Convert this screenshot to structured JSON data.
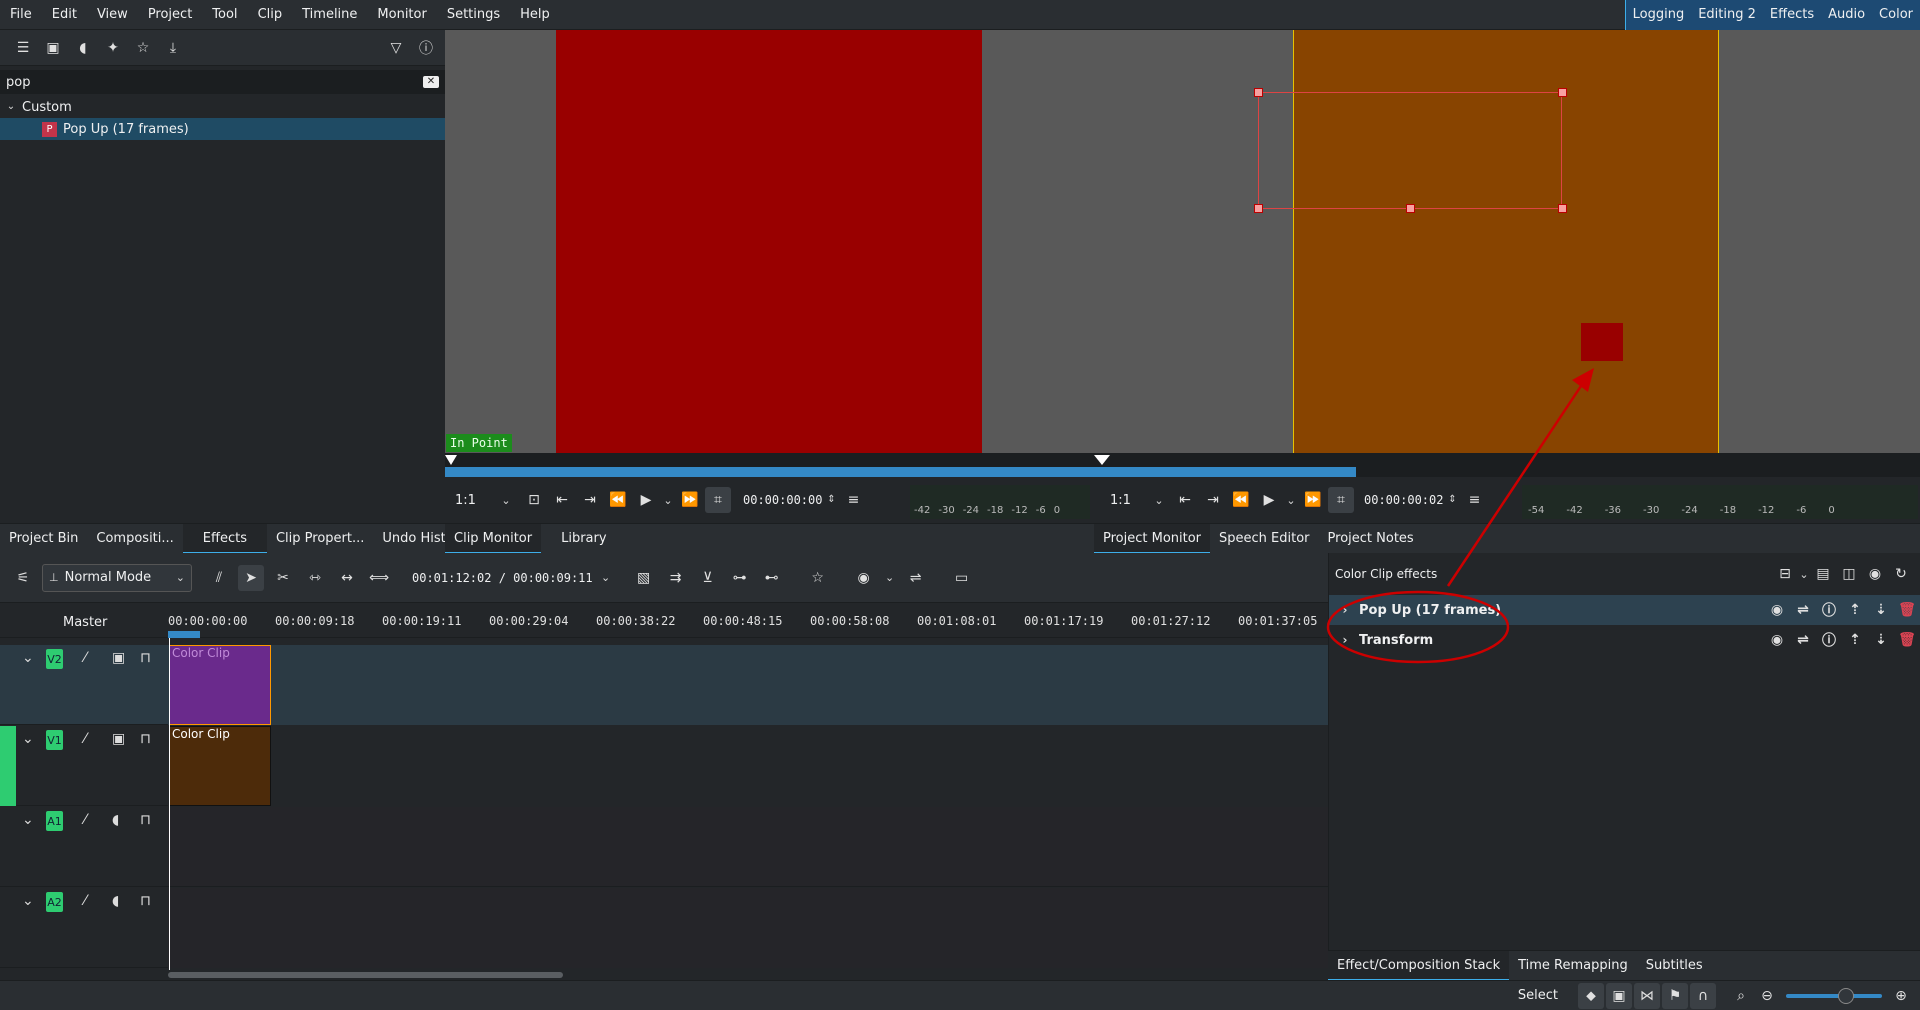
{
  "menu": {
    "items": [
      "File",
      "Edit",
      "View",
      "Project",
      "Tool",
      "Clip",
      "Timeline",
      "Monitor",
      "Settings",
      "Help"
    ],
    "layouts": [
      "Logging",
      "Editing 2",
      "Effects",
      "Audio",
      "Color"
    ]
  },
  "effects_panel": {
    "search_value": "pop",
    "category": "Custom",
    "item": "Pop Up (17 frames)",
    "item_badge": "P"
  },
  "left_tabs": [
    "Project Bin",
    "Compositi...",
    "Effects",
    "Clip Propert...",
    "Undo Hist..."
  ],
  "clip_monitor": {
    "in_point_label": "In Point",
    "zoom": "1:1",
    "timecode": "00:00:00:00",
    "vu_ticks": [
      "-42",
      "-30",
      "-24",
      "-18",
      "-12",
      "-6",
      "0"
    ],
    "tabs": [
      "Clip Monitor",
      "Library"
    ]
  },
  "project_monitor": {
    "zoom": "1:1",
    "timecode": "00:00:00:02",
    "vu_ticks": [
      "-54",
      "-42",
      "-36",
      "-30",
      "-24",
      "-18",
      "-12",
      "-6",
      "0"
    ],
    "tabs": [
      "Project Monitor",
      "Speech Editor",
      "Project Notes"
    ]
  },
  "timeline": {
    "mode": "Normal Mode",
    "timecode": "00:01:12:02 / 00:00:09:11",
    "master_label": "Master",
    "ruler": [
      "00:00:00:00",
      "00:00:09:18",
      "00:00:19:11",
      "00:00:29:04",
      "00:00:38:22",
      "00:00:48:15",
      "00:00:58:08",
      "00:01:08:01",
      "00:01:17:19",
      "00:01:27:12",
      "00:01:37:05"
    ],
    "tracks": [
      {
        "label": "V2",
        "clip": "Color Clip"
      },
      {
        "label": "V1",
        "clip": "Color Clip"
      },
      {
        "label": "A1",
        "clip": ""
      },
      {
        "label": "A2",
        "clip": ""
      }
    ]
  },
  "effect_stack": {
    "title": "Color Clip effects",
    "effects": [
      "Pop Up (17 frames)",
      "Transform"
    ],
    "tabs": [
      "Effect/Composition Stack",
      "Time Remapping",
      "Subtitles"
    ]
  },
  "statusbar": {
    "select_label": "Select"
  },
  "colors": {
    "accent": "#3daee9",
    "clip_monitor_frame": "#990000",
    "project_monitor_frame": "#884400",
    "v2_clip": "#6a2a8c",
    "v1_clip": "#4d2b0a",
    "annotation": "#cc0000"
  }
}
